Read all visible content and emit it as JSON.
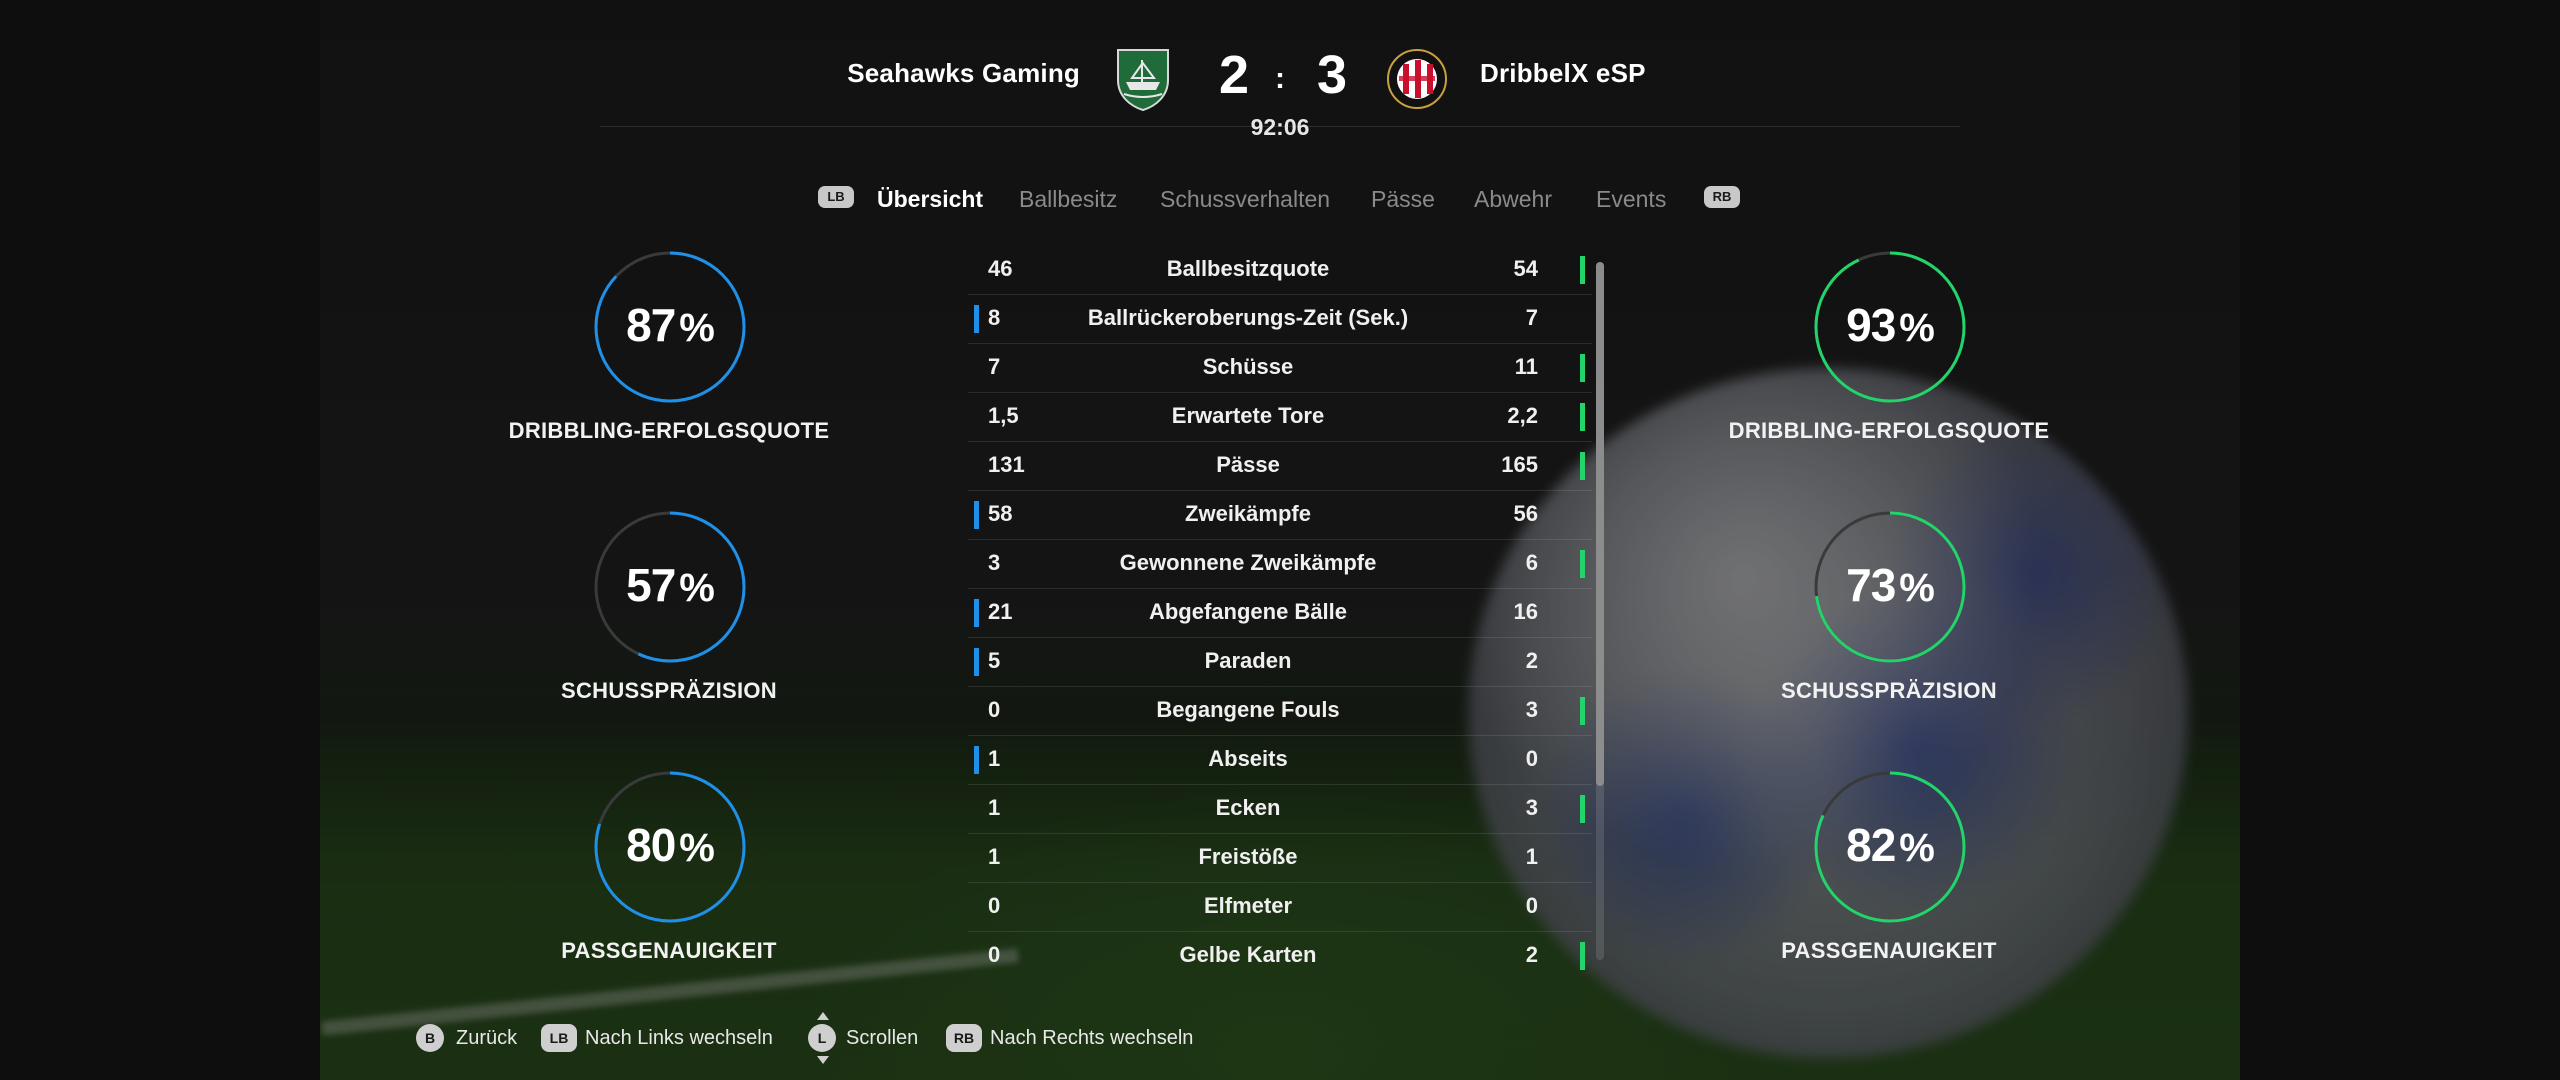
{
  "header": {
    "home_team": "Seahawks Gaming",
    "away_team": "DribbelX eSP",
    "home_score": "2",
    "away_score": "3",
    "separator": ":",
    "clock": "92:06",
    "home_crest_icon": "green-ship-crest-icon",
    "away_crest_icon": "red-black-striped-crest-icon"
  },
  "tabs": {
    "left_hint": "LB",
    "right_hint": "RB",
    "items": [
      {
        "label": "Übersicht",
        "active": true
      },
      {
        "label": "Ballbesitz",
        "active": false
      },
      {
        "label": "Schussverhalten",
        "active": false
      },
      {
        "label": "Pässe",
        "active": false
      },
      {
        "label": "Abwehr",
        "active": false
      },
      {
        "label": "Events",
        "active": false
      }
    ]
  },
  "rings": {
    "home": [
      {
        "value": "87",
        "unit": "%",
        "label": "DRIBBLING-ERFOLGSQUOTE",
        "fraction": 0.87
      },
      {
        "value": "57",
        "unit": "%",
        "label": "SCHUSSPRÄZISION",
        "fraction": 0.57
      },
      {
        "value": "80",
        "unit": "%",
        "label": "PASSGENAUIGKEIT",
        "fraction": 0.8
      }
    ],
    "away": [
      {
        "value": "93",
        "unit": "%",
        "label": "DRIBBLING-ERFOLGSQUOTE",
        "fraction": 0.93
      },
      {
        "value": "73",
        "unit": "%",
        "label": "SCHUSSPRÄZISION",
        "fraction": 0.73
      },
      {
        "value": "82",
        "unit": "%",
        "label": "PASSGENAUIGKEIT",
        "fraction": 0.82
      }
    ]
  },
  "colors": {
    "home_accent": "#1e90e8",
    "away_accent": "#22d46a",
    "ring_track": "#3a3a3a"
  },
  "stats": [
    {
      "home": "46",
      "label": "Ballbesitzquote",
      "away": "54",
      "leader": "away"
    },
    {
      "home": "8",
      "label": "Ballrückeroberungs-Zeit (Sek.)",
      "away": "7",
      "leader": "home"
    },
    {
      "home": "7",
      "label": "Schüsse",
      "away": "11",
      "leader": "away"
    },
    {
      "home": "1,5",
      "label": "Erwartete Tore",
      "away": "2,2",
      "leader": "away"
    },
    {
      "home": "131",
      "label": "Pässe",
      "away": "165",
      "leader": "away"
    },
    {
      "home": "58",
      "label": "Zweikämpfe",
      "away": "56",
      "leader": "home"
    },
    {
      "home": "3",
      "label": "Gewonnene Zweikämpfe",
      "away": "6",
      "leader": "away"
    },
    {
      "home": "21",
      "label": "Abgefangene Bälle",
      "away": "16",
      "leader": "home"
    },
    {
      "home": "5",
      "label": "Paraden",
      "away": "2",
      "leader": "home"
    },
    {
      "home": "0",
      "label": "Begangene Fouls",
      "away": "3",
      "leader": "away"
    },
    {
      "home": "1",
      "label": "Abseits",
      "away": "0",
      "leader": "home"
    },
    {
      "home": "1",
      "label": "Ecken",
      "away": "3",
      "leader": "away"
    },
    {
      "home": "1",
      "label": "Freistöße",
      "away": "1",
      "leader": "none"
    },
    {
      "home": "0",
      "label": "Elfmeter",
      "away": "0",
      "leader": "none"
    },
    {
      "home": "0",
      "label": "Gelbe Karten",
      "away": "2",
      "leader": "away"
    }
  ],
  "footer": {
    "back_key": "B",
    "back_label": "Zurück",
    "left_key": "LB",
    "left_label": "Nach Links wechseln",
    "scroll_key": "L",
    "scroll_label": "Scrollen",
    "right_key": "RB",
    "right_label": "Nach Rechts wechseln"
  }
}
